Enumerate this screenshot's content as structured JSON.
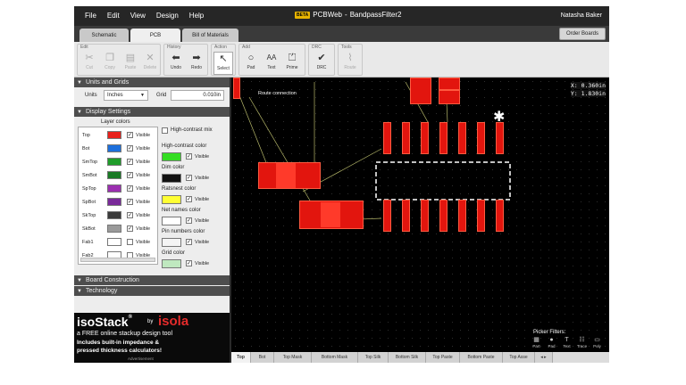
{
  "menu": [
    "File",
    "Edit",
    "View",
    "Design",
    "Help"
  ],
  "app": {
    "beta": "BETA",
    "name": "PCBWeb",
    "separator": "-",
    "doc": "BandpassFilter2",
    "user": "Natasha Baker"
  },
  "tabs": [
    "Schematic",
    "PCB",
    "Bill of Materials"
  ],
  "order_button": "Order Boards",
  "toolbar": {
    "groups": [
      "Edit",
      "History",
      "Action",
      "Add",
      "DRC",
      "Tools"
    ],
    "edit": [
      "Cut",
      "Copy",
      "Paste",
      "Delete"
    ],
    "history": [
      "Undo",
      "Redo"
    ],
    "action": [
      "Select"
    ],
    "add": [
      "Pad",
      "Text",
      "Prime"
    ],
    "drc": [
      "DRC"
    ],
    "tools": [
      "Route"
    ]
  },
  "left": {
    "units_section": "Units and Grids",
    "units_label": "Units",
    "units_value": "Inches",
    "grid_label": "Grid",
    "grid_value": "0.010in",
    "display_section": "Display Settings",
    "layer_colors_label": "Layer colors",
    "layers": [
      {
        "name": "Top",
        "color": "#e8211b",
        "visible": true
      },
      {
        "name": "Bot",
        "color": "#1d6fdc",
        "visible": true
      },
      {
        "name": "SmTop",
        "color": "#1f9d2a",
        "visible": true
      },
      {
        "name": "SmBot",
        "color": "#1a7a25",
        "visible": true
      },
      {
        "name": "SpTop",
        "color": "#9b2fb0",
        "visible": true
      },
      {
        "name": "SpBot",
        "color": "#7a2a9a",
        "visible": true
      },
      {
        "name": "SkTop",
        "color": "#3a3a3a",
        "visible": true
      },
      {
        "name": "SkBot",
        "color": "#9a9a9a",
        "visible": true
      },
      {
        "name": "Fab1",
        "color": "#ffffff",
        "visible": false
      },
      {
        "name": "Fab2",
        "color": "#ffffff",
        "visible": false
      }
    ],
    "visible_label": "Visible",
    "high_contrast_label": "High-contrast mix",
    "color_options": [
      {
        "label": "High-contrast color",
        "color": "#33dd22"
      },
      {
        "label": "Dim color",
        "color": "#111111"
      },
      {
        "label": "Ratsnest color",
        "color": "#ffff33"
      },
      {
        "label": "Net names color",
        "color": "#ffffff"
      },
      {
        "label": "Pin numbers color",
        "color": "#f4f4f4"
      },
      {
        "label": "Grid color",
        "color": "#bfe8bf"
      }
    ],
    "board_construction": "Board Construction",
    "technology": "Technology",
    "banner": {
      "title": "isoStack",
      "reg": "®",
      "by": "by",
      "brand": "isola",
      "line1": "a FREE online stackup design tool",
      "line2": "Includes built-in impedance &",
      "line3": "pressed thickness calculators!",
      "ad": "Advertisement"
    }
  },
  "canvas": {
    "route_label": "Route connection",
    "coord_x": "X: 0.360in",
    "coord_y": "Y: 1.830in",
    "picker_title": "Picker Filters:",
    "pickers": [
      "Part",
      "Pad",
      "Text",
      "Trace",
      "Poly"
    ]
  },
  "layer_tabs": [
    "Top",
    "Bot",
    "Top Mask",
    "Bottom Mask",
    "Top Silk",
    "Bottom Silk",
    "Top Paste",
    "Bottom Paste",
    "Top Asse"
  ],
  "colors": {
    "accent": "#e2150e",
    "panel": "#ededed",
    "header": "#4e4e4e"
  }
}
